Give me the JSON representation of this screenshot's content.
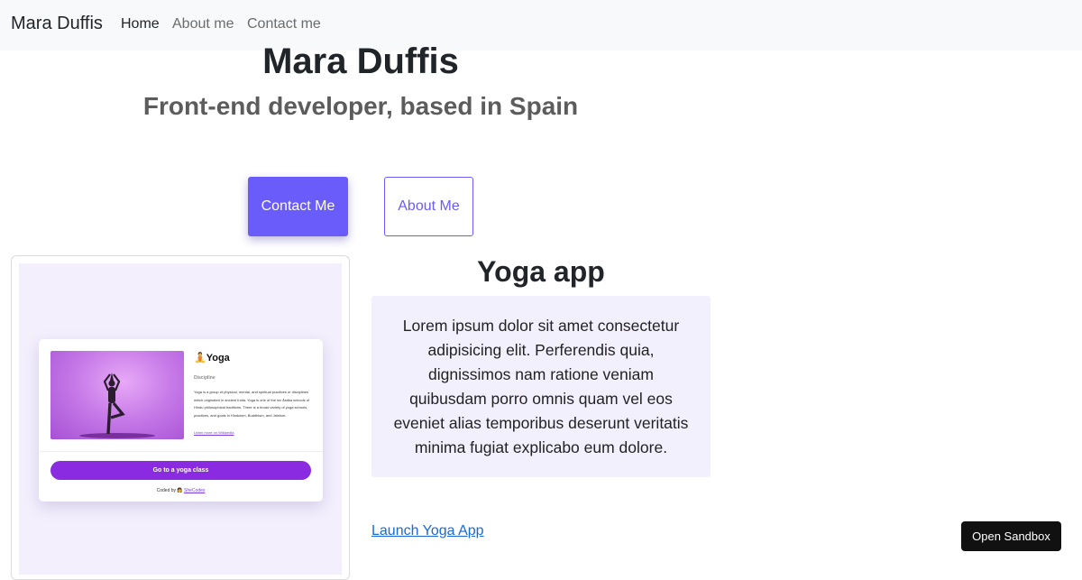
{
  "navbar": {
    "brand": "Mara Duffis",
    "links": [
      {
        "label": "Home",
        "active": true
      },
      {
        "label": "About me",
        "active": false
      },
      {
        "label": "Contact me",
        "active": false
      }
    ]
  },
  "hero": {
    "title": "Mara Duffis",
    "subtitle": "Front-end developer, based in Spain",
    "contact_button": "Contact Me",
    "about_button": "About Me"
  },
  "project": {
    "title": "Yoga app",
    "description": "Lorem ipsum dolor sit amet consectetur adipisicing elit. Perferendis quia, dignissimos nam ratione veniam quibusdam porro omnis quam vel eos eveniet alias temporibus deserunt veritatis minima fugiat explicabo eum dolore.",
    "launch_link": "Launch Yoga App",
    "preview": {
      "title_emoji": "🧘",
      "title": "Yoga",
      "label": "Discipline",
      "description": "Yoga is a group of physical, mental, and spiritual practices or disciplines which originated in ancient India. Yoga is one of the six Āstika schools of Hindu philosophical traditions. There is a broad variety of yoga schools, practices, and goals in Hinduism, Buddhism, and Jainism.",
      "link": "Learn more on Wikipedia",
      "button": "Go to a yoga class",
      "footer_prefix": "Coded by",
      "footer_emoji": "👩",
      "footer_link": "SheCodes"
    }
  },
  "sandbox_button": "Open Sandbox",
  "colors": {
    "accent": "#6a5cfb",
    "yoga_purple": "#8a2be2",
    "panel_bg": "#f3f0fd",
    "link": "#1a6ad6"
  }
}
